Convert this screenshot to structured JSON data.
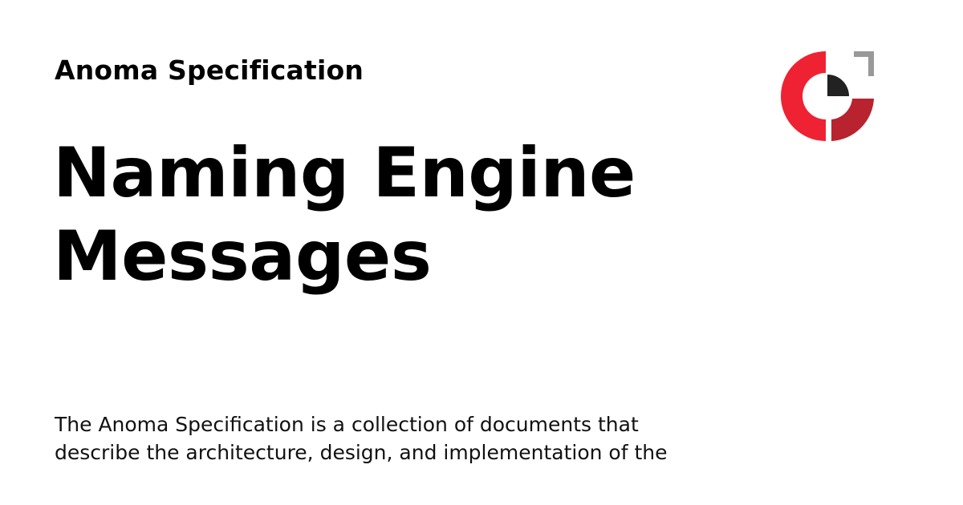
{
  "site": {
    "name": "Anoma Specification"
  },
  "page": {
    "title_lines": [
      "Naming Engine",
      "Messages"
    ]
  },
  "description": {
    "lines": [
      "The Anoma Specification is a collection of documents that",
      "describe the architecture, design, and implementation of the"
    ]
  },
  "logo": {
    "icon": "anoma-logo-icon",
    "colors": {
      "red": "#ee2233",
      "dark_red": "#b8232f",
      "gray": "#999999",
      "black": "#222222"
    }
  }
}
